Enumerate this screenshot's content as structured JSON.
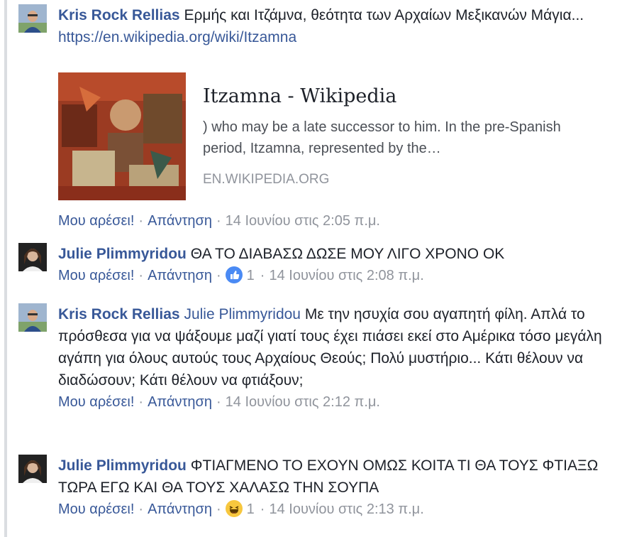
{
  "comments": [
    {
      "author": "Kris Rock Rellias",
      "text": "Ερμής και Ιτζάμνα, θεότητα των Αρχαίων Μεξικανών Μάγια...",
      "link": "https://en.wikipedia.org/wiki/Itzamna",
      "like": "Μου αρέσει!",
      "reply": "Απάντηση",
      "time": "14 Ιουνίου στις 2:05 π.μ."
    },
    {
      "author": "Julie Plimmyridou",
      "text": "ΘΑ ΤΟ ΔΙΑΒΑΣΩ ΔΩΣΕ ΜΟΥ ΛΙΓΟ ΧΡΟΝΟ ΟΚ",
      "like": "Μου αρέσει!",
      "reply": "Απάντηση",
      "reaction_icon": "like-reaction-icon",
      "reaction_count": "1",
      "time": "14 Ιουνίου στις 2:08 π.μ."
    },
    {
      "author": "Kris Rock Rellias",
      "mention": "Julie Plimmyridou",
      "text": "Με την ησυχία σου αγαπητή φίλη. Απλά το πρόσθεσα για να ψάξουμε μαζί γιατί τους έχει πιάσει εκεί στο Αμέρικα τόσο μεγάλη αγάπη για όλους αυτούς τους Αρχαίους Θεούς; Πολύ μυστήριο... Κάτι θέλουν να διαδώσουν; Κάτι θέλουν να φτιάξουν;",
      "like": "Μου αρέσει!",
      "reply": "Απάντηση",
      "time": "14 Ιουνίου στις 2:12 π.μ."
    },
    {
      "author": "Julie Plimmyridou",
      "text": "ΦΤΙΑΓΜΕΝΟ ΤΟ ΕΧΟΥΝ ΟΜΩΣ ΚΟΙΤΑ ΤΙ ΘΑ ΤΟΥΣ ΦΤΙΑΞΩ ΤΩΡΑ ΕΓΩ ΚΑΙ ΘΑ ΤΟΥΣ ΧΑΛΑΣΩ ΤΗΝ ΣΟΥΠΑ",
      "like": "Μου αρέσει!",
      "reply": "Απάντηση",
      "reaction_icon": "haha-reaction-icon",
      "reaction_count": "1",
      "time": "14 Ιουνίου στις 2:13 π.μ."
    }
  ],
  "link_preview": {
    "title": "Itzamna - Wikipedia",
    "description": ") who may be a late successor to him. In the pre-Spanish period, Itzamna, represented by the…",
    "domain": "EN.WIKIPEDIA.ORG"
  },
  "separator": "·",
  "colors": {
    "link": "#385898",
    "meta": "#90949c",
    "like_reaction": "#4a8af4",
    "haha_reaction": "#f7c73e"
  }
}
